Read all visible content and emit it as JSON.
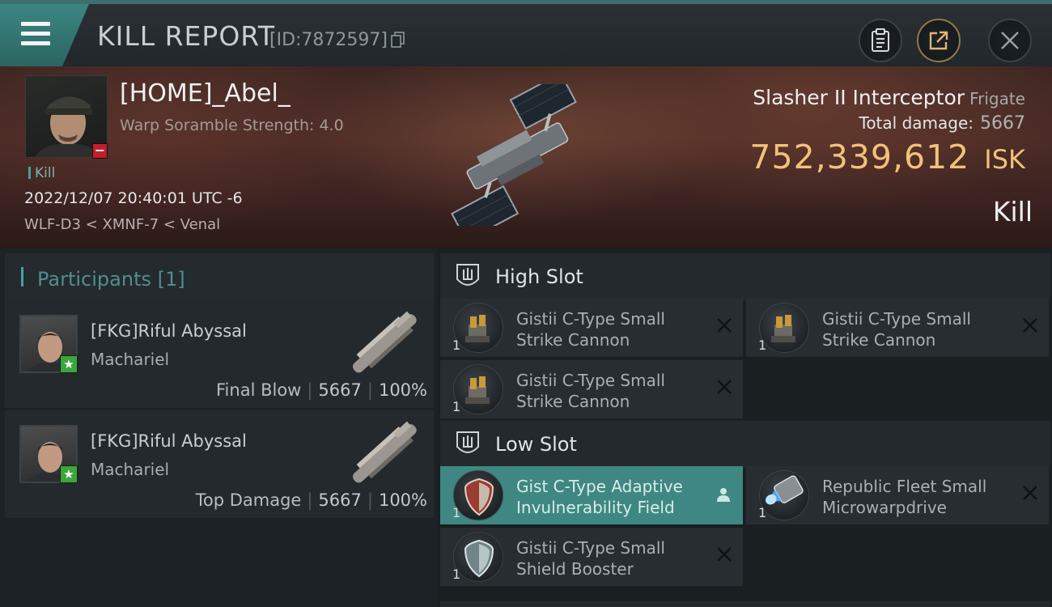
{
  "header": {
    "title": "KILL REPORT",
    "report_id": "[ID:7872597]",
    "icons": [
      "menu-icon",
      "copy-icon",
      "clipboard-icon",
      "share-icon",
      "close-icon"
    ]
  },
  "victim": {
    "name": "[HOME]_Abel_",
    "scramble": "Warp Soramble Strength: 4.0",
    "tag": "Kill",
    "timestamp": "2022/12/07 20:40:01 UTC -6",
    "location": "WLF-D3 < XMNF-7 < Venal",
    "ship_name": "Slasher II Interceptor",
    "ship_class": "Frigate",
    "total_damage_label": "Total damage:",
    "total_damage": "5667",
    "isk_value": "752,339,612",
    "isk_unit": "ISK",
    "result": "Kill"
  },
  "participants": {
    "title": "Participants [1]",
    "rows": [
      {
        "name": "[FKG]Riful Abyssal",
        "ship": "Machariel",
        "role": "Final Blow",
        "damage": "5667",
        "percent": "100%"
      },
      {
        "name": "[FKG]Riful Abyssal",
        "ship": "Machariel",
        "role": "Top Damage",
        "damage": "5667",
        "percent": "100%"
      }
    ]
  },
  "fitting": {
    "high_slot": {
      "title": "High Slot",
      "modules": [
        {
          "line1": "Gistii C-Type Small",
          "line2": "Strike Cannon",
          "qty": "1"
        },
        {
          "line1": "Gistii C-Type Small",
          "line2": "Strike Cannon",
          "qty": "1"
        },
        {
          "line1": "Gistii C-Type Small",
          "line2": "Strike Cannon",
          "qty": "1"
        }
      ]
    },
    "low_slot": {
      "title": "Low Slot",
      "modules": [
        {
          "line1": "Gist C-Type Adaptive",
          "line2": "Invulnerability Field",
          "qty": "1",
          "selected": true
        },
        {
          "line1": "Republic Fleet Small",
          "line2": "Microwarpdrive",
          "qty": "1"
        },
        {
          "line1": "Gistii C-Type Small",
          "line2": "Shield Booster",
          "qty": "1"
        }
      ]
    }
  },
  "colors": {
    "accent": "#3f8782",
    "isk": "#f0c27a",
    "badge_red": "#c0202a",
    "badge_green": "#3da53d"
  }
}
